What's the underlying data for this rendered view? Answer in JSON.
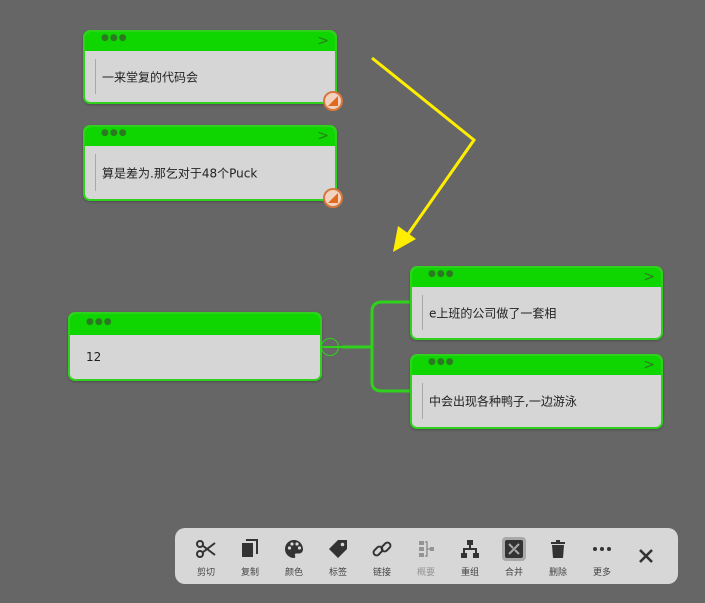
{
  "nodes": {
    "node1": "一来堂复的代码会",
    "node2": "算是差为.那乞对于48个Puck",
    "root": "12",
    "child1": "e上班的公司做了一套相",
    "child2": "中会出现各种鸭子,一边游泳"
  },
  "toolbar": {
    "cut": "剪切",
    "copy": "复制",
    "color": "颜色",
    "tag": "标签",
    "link": "链接",
    "summary": "概要",
    "regroup": "重组",
    "merge": "合并",
    "delete": "删除",
    "more": "更多"
  },
  "colors": {
    "background": "#666666",
    "node_header": "#0fd600",
    "node_body": "#d6d6d6",
    "connector": "#2fd11d",
    "arrow": "#ffee00",
    "badge_border": "#d6783b"
  }
}
